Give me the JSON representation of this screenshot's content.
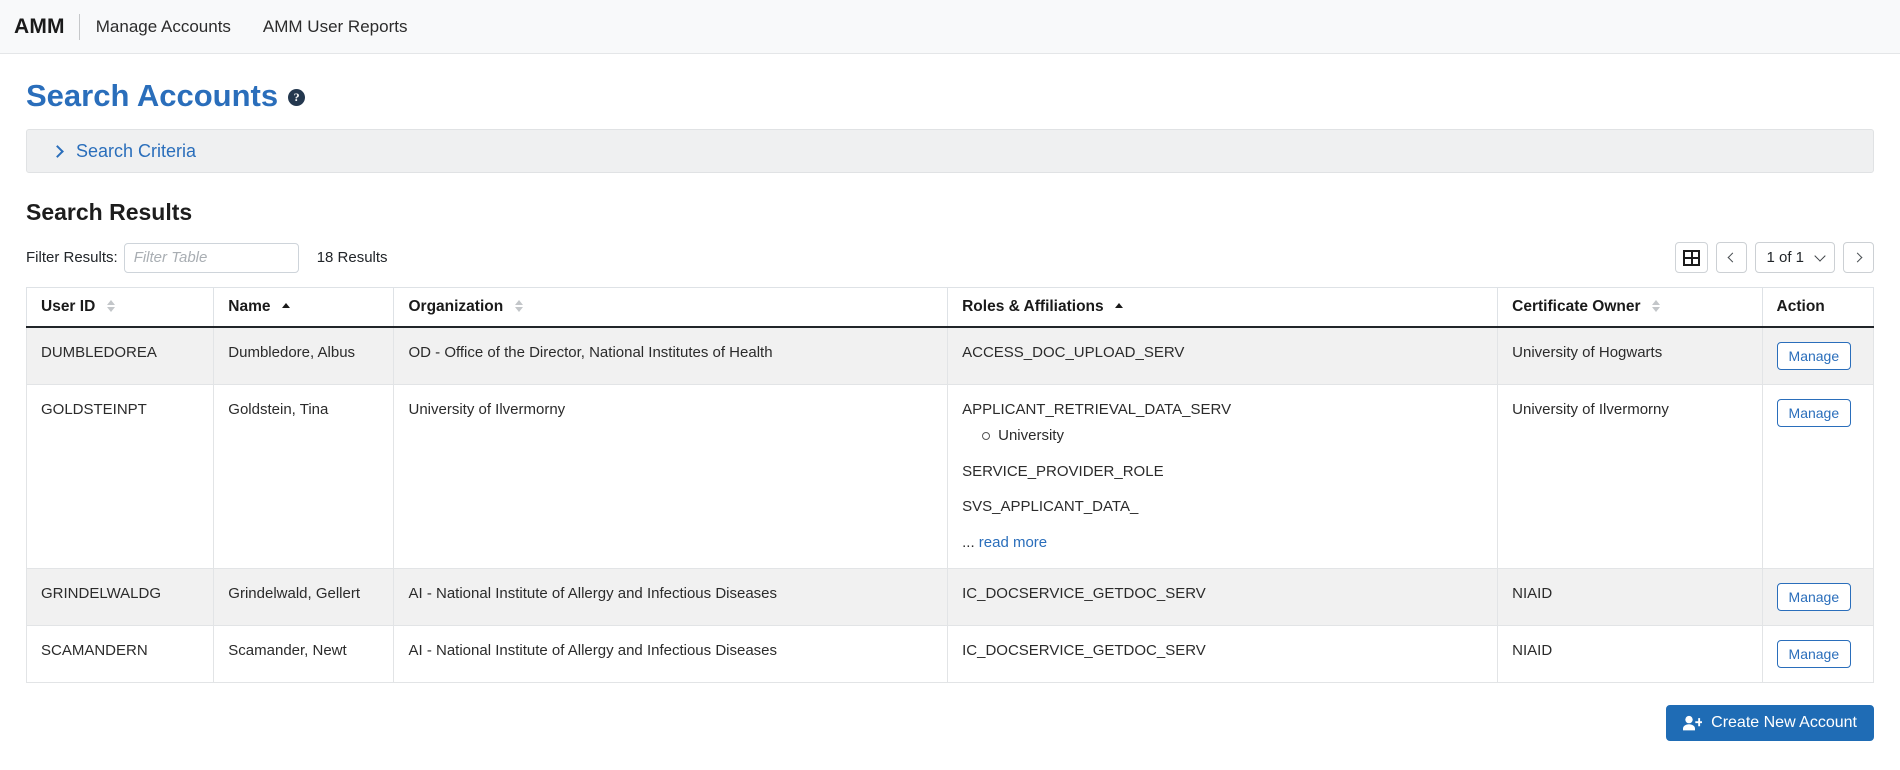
{
  "nav": {
    "brand": "AMM",
    "links": [
      {
        "label": "Manage Accounts"
      },
      {
        "label": "AMM User Reports"
      }
    ]
  },
  "page": {
    "title": "Search Accounts",
    "help_icon": "help-circle-icon",
    "criteria_panel": {
      "label": "Search Criteria",
      "icon": "chevron-right-icon",
      "expanded": false
    },
    "results_heading": "Search Results"
  },
  "toolbar": {
    "filter_label": "Filter Results:",
    "filter_placeholder": "Filter Table",
    "filter_value": "",
    "results_count": "18 Results",
    "grid_icon": "table-grid-icon",
    "prev_icon": "chevron-left-icon",
    "next_icon": "chevron-right-icon",
    "page_indicator": "1 of 1",
    "page_caret_icon": "chevron-down-icon"
  },
  "table": {
    "columns": [
      {
        "label": "User ID",
        "sort": "none"
      },
      {
        "label": "Name",
        "sort": "asc"
      },
      {
        "label": "Organization",
        "sort": "none"
      },
      {
        "label": "Roles & Affiliations",
        "sort": "asc"
      },
      {
        "label": "Certificate Owner",
        "sort": "none"
      },
      {
        "label": "Action",
        "sort": "unsortable"
      }
    ],
    "rows": [
      {
        "user_id": "DUMBLEDOREA",
        "name": "Dumbledore, Albus",
        "organization": "OD - Office of the Director, National Institutes of Health",
        "roles": [
          {
            "name": "ACCESS_DOC_UPLOAD_SERV",
            "affiliations": []
          }
        ],
        "truncated": false,
        "ellipsis": "",
        "read_more": "",
        "certificate_owner": "University of Hogwarts",
        "action_label": "Manage"
      },
      {
        "user_id": "GOLDSTEINPT",
        "name": "Goldstein, Tina",
        "organization": "University of Ilvermorny",
        "roles": [
          {
            "name": "APPLICANT_RETRIEVAL_DATA_SERV",
            "affiliations": [
              "University"
            ]
          },
          {
            "name": "SERVICE_PROVIDER_ROLE",
            "affiliations": []
          },
          {
            "name": "SVS_APPLICANT_DATA_",
            "affiliations": []
          }
        ],
        "truncated": true,
        "ellipsis": "...",
        "read_more": "read more",
        "certificate_owner": "University of Ilvermorny",
        "action_label": "Manage"
      },
      {
        "user_id": "GRINDELWALDG",
        "name": "Grindelwald, Gellert",
        "organization": "AI - National Institute of Allergy and Infectious Diseases",
        "roles": [
          {
            "name": "IC_DOCSERVICE_GETDOC_SERV",
            "affiliations": []
          }
        ],
        "truncated": false,
        "ellipsis": "",
        "read_more": "",
        "certificate_owner": "NIAID",
        "action_label": "Manage"
      },
      {
        "user_id": "SCAMANDERN",
        "name": "Scamander, Newt",
        "organization": "AI - National Institute of Allergy and Infectious Diseases",
        "roles": [
          {
            "name": "IC_DOCSERVICE_GETDOC_SERV",
            "affiliations": []
          }
        ],
        "truncated": false,
        "ellipsis": "",
        "read_more": "",
        "certificate_owner": "NIAID",
        "action_label": "Manage"
      }
    ]
  },
  "footer": {
    "create_label": "Create New Account",
    "create_icon": "user-plus-icon"
  },
  "colors": {
    "brand_blue": "#2a6ebb",
    "button_blue": "#1f6cb5",
    "nav_bg": "#f8f9fa",
    "panel_bg": "#eff0f1",
    "row_alt_bg": "#f1f1f1"
  }
}
